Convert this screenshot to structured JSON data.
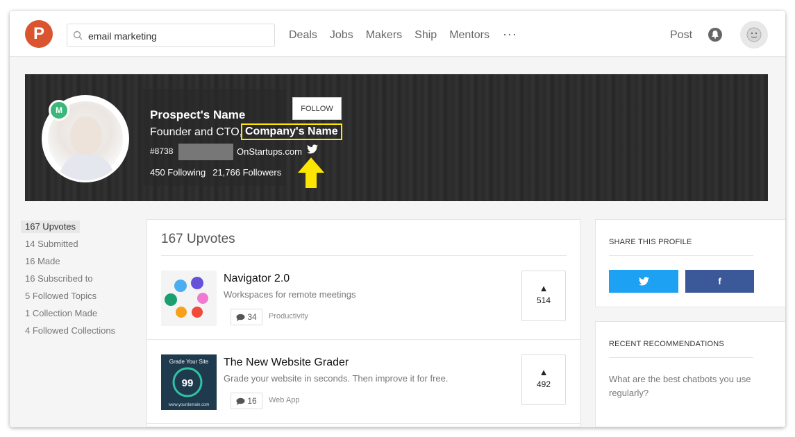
{
  "topbar": {
    "logo_letter": "P",
    "search_value": "email marketing",
    "nav": [
      "Deals",
      "Jobs",
      "Makers",
      "Ship",
      "Mentors"
    ],
    "more": "···",
    "post_label": "Post"
  },
  "profile": {
    "name": "Prospect's Name",
    "follow_label": "FOLLOW",
    "headline_prefix": "Founder and CTO,",
    "company": "Company's Name",
    "rank": "#8738",
    "website": "OnStartups.com",
    "following": "450 Following",
    "followers": "21,766 Followers",
    "badge": "M"
  },
  "sidebar": {
    "items": [
      "167 Upvotes",
      "14 Submitted",
      "16 Made",
      "16 Subscribed to",
      "5 Followed Topics",
      "1 Collection Made",
      "4 Followed Collections"
    ]
  },
  "main": {
    "title": "167 Upvotes",
    "posts": [
      {
        "title": "Navigator 2.0",
        "tagline": "Workspaces for remote meetings",
        "comments": "34",
        "topic": "Productivity",
        "votes": "514",
        "vote_arrow": "▲"
      },
      {
        "title": "The New Website Grader",
        "tagline": "Grade your website in seconds. Then improve it for free.",
        "comments": "16",
        "topic": "Web App",
        "votes": "492",
        "vote_arrow": "▲",
        "thumb_title": "Grade Your Site",
        "thumb_score": "99",
        "thumb_domain": "www.yourdomain.com"
      }
    ]
  },
  "share": {
    "heading": "SHARE THIS PROFILE",
    "facebook_label": "f"
  },
  "recommendations": {
    "heading": "RECENT RECOMMENDATIONS",
    "item": "What are the best chatbots you use regularly?"
  },
  "colors": {
    "brand": "#da552f",
    "twitter": "#1da1f2",
    "facebook": "#3b5998",
    "highlight": "#ffe600"
  }
}
